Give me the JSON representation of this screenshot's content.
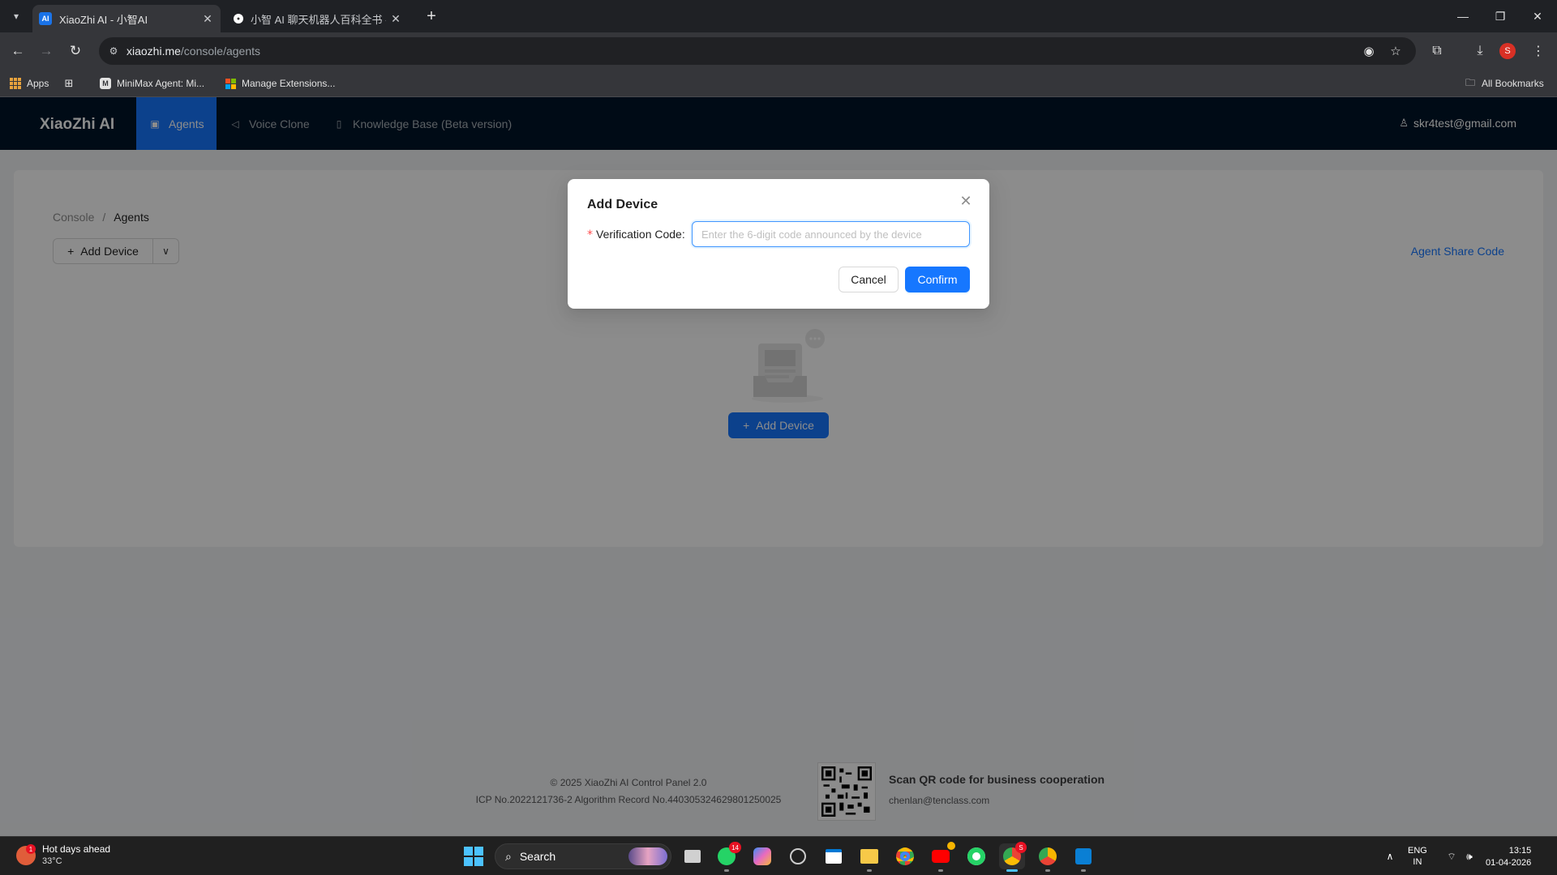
{
  "browser": {
    "tabs": [
      {
        "title": "XiaoZhi AI - 小智AI",
        "favicon": "AI",
        "active": true
      },
      {
        "title": "小智 AI 聊天机器人百科全书 - F",
        "favicon": "ai-chat-icon",
        "active": false
      }
    ],
    "url_host": "xiaozhi.me",
    "url_path": "/console/agents",
    "profile_initial": "S",
    "bookmarks": [
      {
        "label": "Apps",
        "icon": "apps-grid-icon"
      },
      {
        "label": "",
        "icon": "tab-groups-icon"
      },
      {
        "label": "MiniMax Agent: Mi...",
        "icon": "minimax-icon"
      },
      {
        "label": "Manage Extensions...",
        "icon": "ms-store-icon"
      }
    ],
    "all_bookmarks": "All Bookmarks"
  },
  "app": {
    "brand": "XiaoZhi AI",
    "menu": [
      {
        "label": "Agents",
        "icon": "robot-icon",
        "active": true
      },
      {
        "label": "Voice Clone",
        "icon": "speaker-icon",
        "active": false
      },
      {
        "label": "Knowledge Base (Beta version)",
        "icon": "book-icon",
        "active": false
      }
    ],
    "user_email": "skr4test@gmail.com"
  },
  "content": {
    "breadcrumb": [
      "Console",
      "Agents"
    ],
    "add_device_label": "Add Device",
    "share_code_label": "Agent Share Code",
    "empty_add_label": "Add Device"
  },
  "footer": {
    "copyright": "© 2025 XiaoZhi AI Control Panel 2.0",
    "icp": "ICP No.2022121736-2 Algorithm Record No.440305324629801250025",
    "qr_title": "Scan QR code for business cooperation",
    "qr_email": "chenlan@tenclass.com"
  },
  "modal": {
    "title": "Add Device",
    "field_label": "Verification Code:",
    "field_required": "*",
    "input_value": "",
    "input_placeholder": "Enter the 6-digit code announced by the device",
    "cancel_label": "Cancel",
    "confirm_label": "Confirm"
  },
  "taskbar": {
    "weather_title": "Hot days ahead",
    "weather_temp": "33°C",
    "weather_badge": "1",
    "search_label": "Search",
    "whatsapp_badge": "14",
    "chrome_badge": "S",
    "lang_line1": "ENG",
    "lang_line2": "IN",
    "time": "13:15",
    "date": "01-04-2026"
  },
  "colors": {
    "primary": "#1677ff",
    "header_bg": "#001529",
    "danger": "#ff4d4f"
  }
}
